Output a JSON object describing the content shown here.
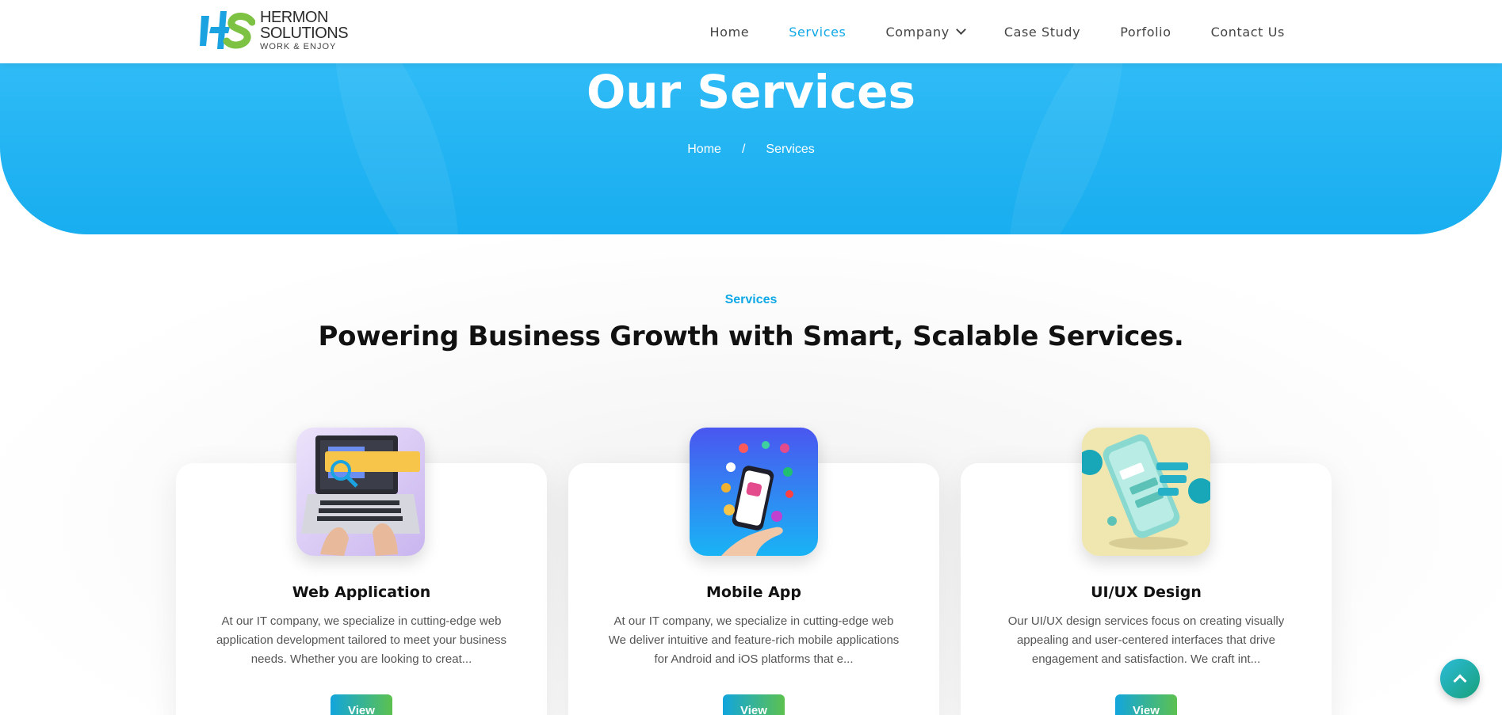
{
  "brand": {
    "name_line1": "HERMON",
    "name_line2": "SOLUTIONS",
    "tagline": "WORK & ENJOY",
    "colors": {
      "blue": "#1aa3e0",
      "green": "#7dc243"
    }
  },
  "nav": {
    "items": [
      {
        "label": "Home",
        "active": false
      },
      {
        "label": "Services",
        "active": true
      },
      {
        "label": "Company",
        "active": false,
        "has_dropdown": true
      },
      {
        "label": "Case Study",
        "active": false
      },
      {
        "label": "Porfolio",
        "active": false
      },
      {
        "label": "Contact Us",
        "active": false
      }
    ],
    "accent_color": "#0fa8e6"
  },
  "hero": {
    "title": "Our Services",
    "breadcrumb": {
      "home": "Home",
      "separator": "/",
      "current": "Services"
    },
    "background": "#1ab2f3"
  },
  "section": {
    "eyebrow": "Services",
    "title": "Powering Business Growth with Smart, Scalable Services."
  },
  "cards": [
    {
      "title": "Web Application",
      "description": "At our IT company, we specialize in cutting-edge web application development tailored to meet your business needs. Whether you are looking to creat...",
      "button": "View",
      "icon": "laptop-image"
    },
    {
      "title": "Mobile App",
      "description": "At our IT company, we specialize in cutting-edge web We deliver intuitive and feature-rich mobile applications for Android and iOS platforms that e...",
      "button": "View",
      "icon": "phone-apps-image"
    },
    {
      "title": "UI/UX Design",
      "description": "Our UI/UX design services focus on creating visually appealing and user-centered interfaces that drive engagement and satisfaction. We craft int...",
      "button": "View",
      "icon": "uiux-phone-image"
    }
  ],
  "scroll_top": {
    "icon": "chevron-up-icon"
  }
}
